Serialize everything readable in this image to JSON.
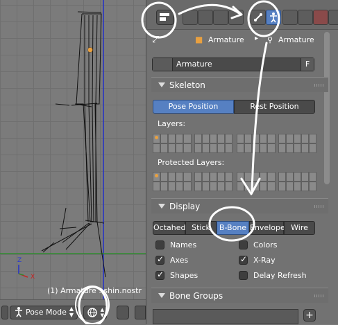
{
  "viewport": {
    "object_label": "(1) Armature : shin.nostr",
    "axis_x": "X",
    "axis_z": "Z",
    "mode_label": "Pose Mode"
  },
  "breadcrumb": {
    "item1": "Armature",
    "item2": "Armature"
  },
  "datablock": {
    "name": "Armature",
    "fake_user": "F"
  },
  "skeleton": {
    "title": "Skeleton",
    "pose_position": "Pose Position",
    "rest_position": "Rest Position",
    "layers_label": "Layers:",
    "protected_label": "Protected Layers:"
  },
  "display": {
    "title": "Display",
    "buttons": [
      "Octahed",
      "Stick",
      "B-Bone",
      "Envelope",
      "Wire"
    ],
    "names": "Names",
    "colors": "Colors",
    "axes": "Axes",
    "xray": "X-Ray",
    "shapes": "Shapes",
    "delay_refresh": "Delay Refresh"
  },
  "bone_groups": {
    "title": "Bone Groups"
  },
  "colors": {
    "accent": "#5680c2",
    "annotation": "#ffffff"
  }
}
